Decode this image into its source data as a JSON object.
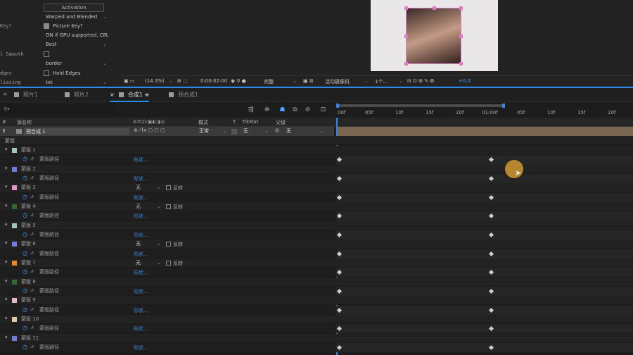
{
  "effects": {
    "activation": "Activation",
    "warp_mode": "Warped and Blended",
    "key_label": "Key?",
    "picture_key": "Picture Key?",
    "gpu_label": "ON if GPU supported, CPL",
    "quality": "Best",
    "smooth_label": "l Smooth",
    "border": "border",
    "hold_label": "dges",
    "hold_edges": "Hold Edges",
    "aliasing_label": "liasing",
    "aliasing_val": "txt"
  },
  "compbar": {
    "zoom": "(14.3%)",
    "timecode": "0:00:02:00",
    "resolution": "完整",
    "camera": "活动摄像机",
    "views": "1个...",
    "exposure": "+0.0"
  },
  "tabs": [
    {
      "label": "照片1",
      "color": "#9b9b9b"
    },
    {
      "label": "照片2",
      "color": "#9b9b9b"
    },
    {
      "label": "合成1",
      "color": "#9b9b9b"
    },
    {
      "label": "预合成1",
      "color": "#9b9b9b"
    }
  ],
  "ruler": {
    "ticks": [
      "00f",
      "05f",
      "10f",
      "15f",
      "20f",
      "01:00f",
      "05f",
      "10f",
      "15f",
      "20f"
    ]
  },
  "headers": {
    "num": "#",
    "name": "源名称",
    "mode": "模式",
    "t": "T",
    "trkmat": "TrkMat",
    "parent": "父级"
  },
  "layer": {
    "num": "3",
    "name": "预合成 1",
    "mode": "正常",
    "trkmat": "无",
    "parent": "无"
  },
  "masks_label": "蒙版",
  "masks": [
    {
      "name": "蒙版 1",
      "color": "#9fc7b7",
      "path": "蒙版路径",
      "shape": "形状...",
      "mode": "",
      "inverted": ""
    },
    {
      "name": "蒙版 2",
      "color": "#6f7be0",
      "path": "蒙版路径",
      "shape": "形状...",
      "mode": "",
      "inverted": ""
    },
    {
      "name": "蒙版 3",
      "color": "#e691c7",
      "path": "蒙版路径",
      "shape": "形状...",
      "mode": "无",
      "inverted": "反转"
    },
    {
      "name": "蒙版 4",
      "color": "#2f6a2f",
      "path": "蒙版路径",
      "shape": "形状...",
      "mode": "无",
      "inverted": "反转"
    },
    {
      "name": "蒙版 5",
      "color": "#9fc7b7",
      "path": "蒙版路径",
      "shape": "形状...",
      "mode": "",
      "inverted": ""
    },
    {
      "name": "蒙版 6",
      "color": "#6f7be0",
      "path": "蒙版路径",
      "shape": "形状...",
      "mode": "无",
      "inverted": "反转"
    },
    {
      "name": "蒙版 7",
      "color": "#ee8a1e",
      "path": "蒙版路径",
      "shape": "形状...",
      "mode": "无",
      "inverted": "反转"
    },
    {
      "name": "蒙版 8",
      "color": "#2f6a2f",
      "path": "蒙版路径",
      "shape": "形状...",
      "mode": "",
      "inverted": ""
    },
    {
      "name": "蒙版 9",
      "color": "#e3b8c3",
      "path": "蒙版路径",
      "shape": "形状...",
      "mode": "",
      "inverted": ""
    },
    {
      "name": "蒙版 10",
      "color": "#e3c6a5",
      "path": "蒙版路径",
      "shape": "形状...",
      "mode": "",
      "inverted": ""
    },
    {
      "name": "蒙版 11",
      "color": "#6f7be0",
      "path": "蒙版路径",
      "shape": "形状...",
      "mode": "",
      "inverted": ""
    }
  ]
}
